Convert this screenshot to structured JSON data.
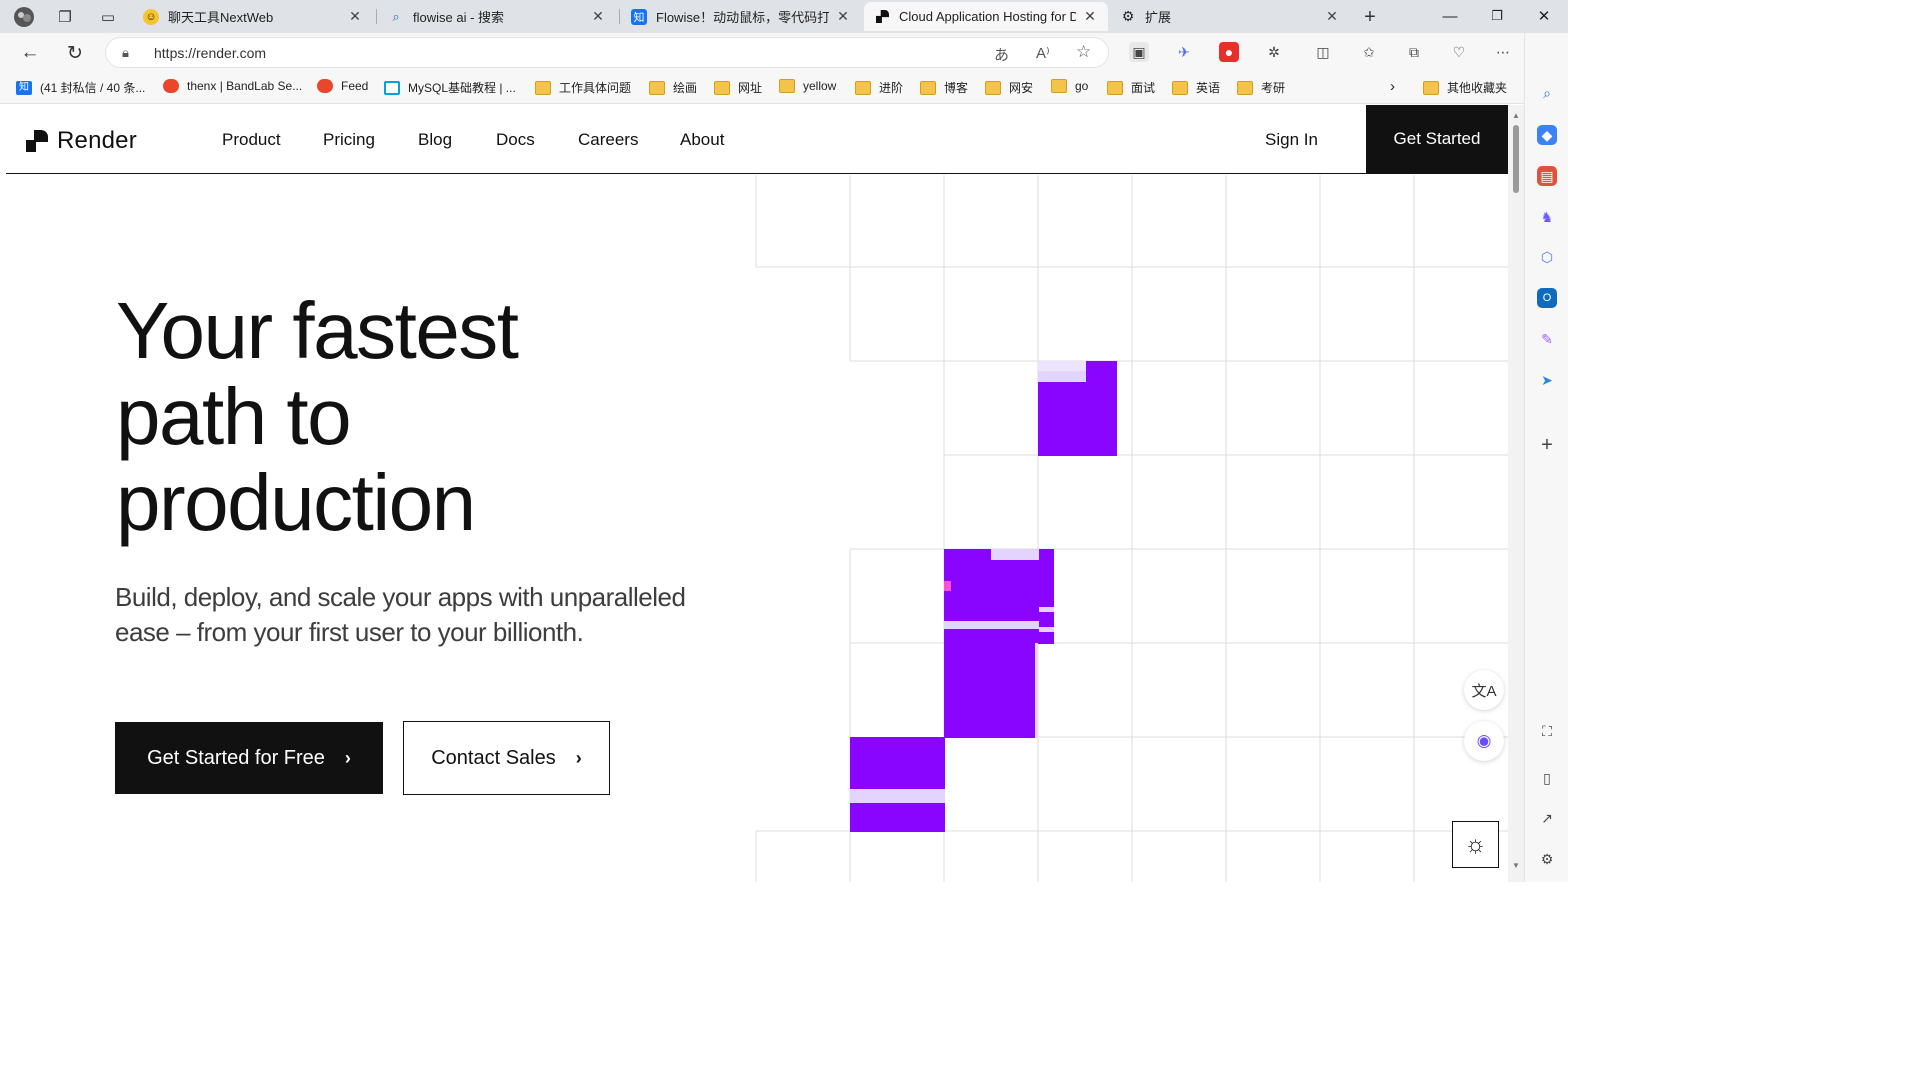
{
  "browser": {
    "tabs": [
      {
        "title": "聊天工具NextWeb",
        "favicon": "smiley-icon"
      },
      {
        "title": "flowise ai - 搜索",
        "favicon": "search-icon"
      },
      {
        "title": "Flowise！动动鼠标，零代码打造",
        "favicon": "zhihu-icon",
        "favicon_text": "知"
      },
      {
        "title": "Cloud Application Hosting for De",
        "favicon": "render-icon"
      },
      {
        "title": "扩展",
        "favicon": "extension-icon"
      }
    ],
    "url": "https://render.com",
    "bookmarks": [
      {
        "label": "(41 封私信 / 40 条...",
        "icon": "zhihu-icon",
        "icon_text": "知"
      },
      {
        "label": "thenx | BandLab Se...",
        "icon": "bandlab-icon"
      },
      {
        "label": "Feed",
        "icon": "bandlab-icon"
      },
      {
        "label": "MySQL基础教程 | ...",
        "icon": "bilibili-icon"
      },
      {
        "label": "工作具体问题",
        "icon": "folder-icon"
      },
      {
        "label": "绘画",
        "icon": "folder-icon"
      },
      {
        "label": "网址",
        "icon": "folder-icon"
      },
      {
        "label": "yellow",
        "icon": "folder-icon"
      },
      {
        "label": "进阶",
        "icon": "folder-icon"
      },
      {
        "label": "博客",
        "icon": "folder-icon"
      },
      {
        "label": "网安",
        "icon": "folder-icon"
      },
      {
        "label": "go",
        "icon": "folder-icon"
      },
      {
        "label": "面试",
        "icon": "folder-icon"
      },
      {
        "label": "英语",
        "icon": "folder-icon"
      },
      {
        "label": "考研",
        "icon": "folder-icon"
      },
      {
        "label": "其他收藏夹",
        "icon": "folder-icon"
      }
    ]
  },
  "site": {
    "logo_text": "Render",
    "nav": [
      "Product",
      "Pricing",
      "Blog",
      "Docs",
      "Careers",
      "About"
    ],
    "sign_in": "Sign In",
    "get_started": "Get Started",
    "hero": {
      "title_lines": [
        "Your fastest",
        "path to",
        "production"
      ],
      "subtitle_lines": [
        "Build, deploy, and scale your apps with unparalleled",
        "ease – from your first user to your billionth."
      ],
      "cta_primary": "Get Started for Free",
      "cta_secondary": "Contact Sales"
    },
    "colors": {
      "accent": "#8a05ff",
      "accent_light": "#e3d4ff",
      "ink": "#111111"
    }
  }
}
